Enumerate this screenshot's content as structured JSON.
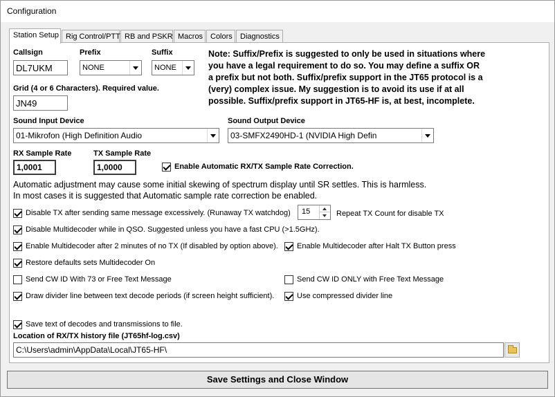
{
  "window": {
    "title": "Configuration"
  },
  "tabs": [
    {
      "label": "Station Setup"
    },
    {
      "label": "Rig Control/PTT"
    },
    {
      "label": "RB and PSKR"
    },
    {
      "label": "Macros"
    },
    {
      "label": "Colors"
    },
    {
      "label": "Diagnostics"
    }
  ],
  "station": {
    "callsign_label": "Callsign",
    "callsign_value": "DL7UKM",
    "prefix_label": "Prefix",
    "prefix_value": "NONE",
    "suffix_label": "Suffix",
    "suffix_value": "NONE",
    "grid_label": "Grid (4 or 6 Characters).  Required value.",
    "grid_value": "JN49"
  },
  "note": {
    "lines": [
      "Note:  Suffix/Prefix is suggested to only be used in situations where",
      "you have a legal requirement to do so.  You may define a suffix OR",
      "a prefix but not both.  Suffix/prefix support in the JT65 protocol is a",
      "(very) complex issue.  My suggestion is to avoid its use if at all",
      "possible.  Suffix/prefix support in JT65-HF is, at best, incomplete."
    ]
  },
  "sound": {
    "input_label": "Sound Input Device",
    "input_value": "01-Mikrofon (High Definition Audio",
    "output_label": "Sound Output Device",
    "output_value": "03-SMFX2490HD-1 (NVIDIA High Defin"
  },
  "sample": {
    "rx_label": "RX Sample Rate",
    "rx_value": "1,0001",
    "tx_label": "TX Sample Rate",
    "tx_value": "1,0000",
    "auto_label": "Enable Automatic RX/TX Sample Rate Correction.",
    "info_line1": "Automatic adjustment may cause some initial skewing of spectrum display until SR settles.  This is harmless.",
    "info_line2": "In most cases it is suggested that Automatic sample rate correction be enabled."
  },
  "options": {
    "disable_tx": "Disable TX after sending same message excessively. (Runaway TX watchdog)",
    "repeat_count": "15",
    "repeat_label": "Repeat TX Count for disable TX",
    "disable_multi": "Disable Multidecoder while in QSO.  Suggested unless you have a fast CPU (>1.5GHz).",
    "enable_multi_2min": "Enable Multidecoder after 2 minutes of no TX (If disabled by option above).",
    "enable_multi_halt": "Enable Multidecoder after Halt TX Button press",
    "restore_defaults": "Restore defaults sets Multidecoder On",
    "send_cw_id": "Send CW ID With 73 or Free Text Message",
    "send_cw_only": "Send CW ID ONLY with Free Text Message",
    "draw_divider": "Draw divider line between text decode periods (if screen height sufficient).",
    "compressed_divider": "Use compressed divider line",
    "save_text": "Save text of decodes and transmissions to file."
  },
  "history": {
    "label": "Location of RX/TX history file (JT65hf-log.csv)",
    "path": "C:\\Users\\admin\\AppData\\Local\\JT65-HF\\"
  },
  "footer": {
    "save_label": "Save Settings and Close Window"
  }
}
